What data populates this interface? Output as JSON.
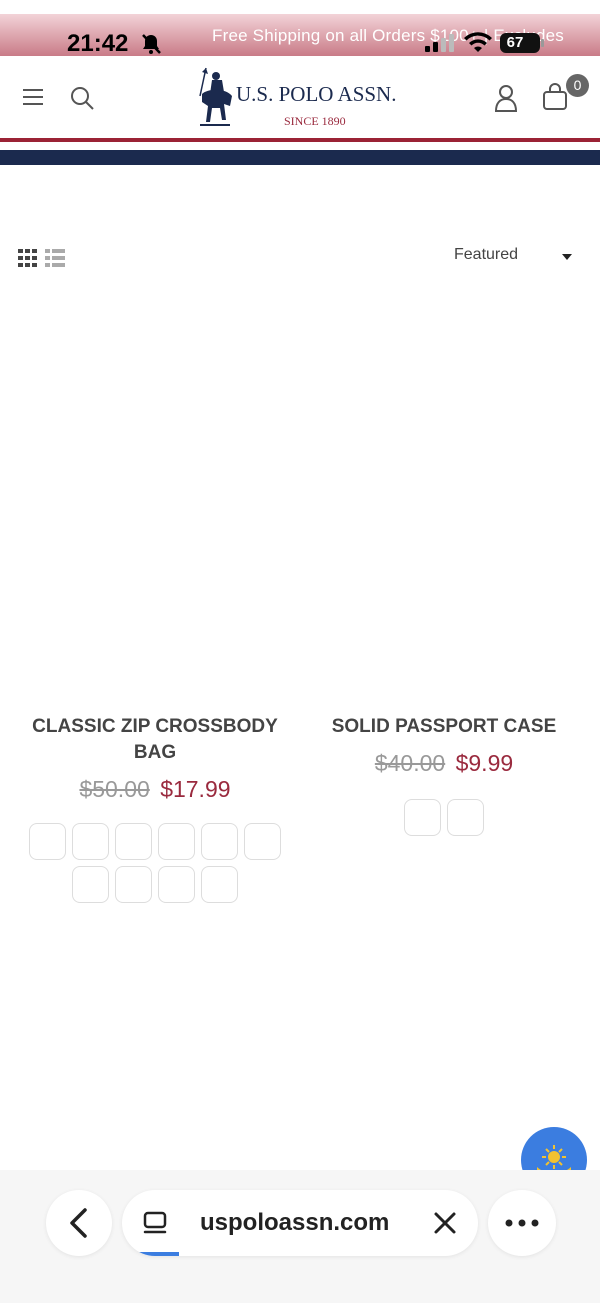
{
  "status_bar": {
    "time": "21:42",
    "battery": "67"
  },
  "promo_banner": {
    "text": "Free Shipping on all Orders $100+ | Excludes"
  },
  "header": {
    "logo_title": "U.S. POLO ASSN.",
    "logo_subtitle": "SINCE 1890",
    "cart_count": "0"
  },
  "toolbar": {
    "sort_selected": "Featured"
  },
  "products": [
    {
      "title": "CLASSIC ZIP CROSSBODY BAG",
      "price_old": "$50.00",
      "price_new": "$17.99",
      "swatch_count": 10
    },
    {
      "title": "SOLID PASSPORT CASE",
      "price_old": "$40.00",
      "price_new": "$9.99",
      "swatch_count": 2
    }
  ],
  "browser": {
    "url": "uspoloassn.com",
    "load_progress_fraction": 0.16
  },
  "colors": {
    "brand_navy": "#1b2a4e",
    "brand_red": "#9a2a3e",
    "accent_blue": "#3b7de0"
  },
  "icons": {
    "menu": "menu-icon",
    "search": "search-icon",
    "account": "account-icon",
    "cart": "cart-icon",
    "grid_view": "grid-view-icon",
    "list_view": "list-view-icon",
    "back": "back-icon",
    "tabs": "tabs-icon",
    "close": "close-icon",
    "more": "more-icon"
  }
}
